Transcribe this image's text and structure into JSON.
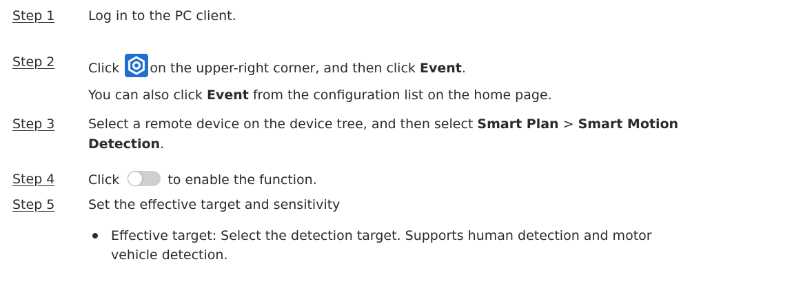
{
  "steps": [
    {
      "label": "Step 1",
      "text": "Log in to the PC client."
    },
    {
      "label": "Step 2",
      "pre": "Click",
      "icon": "gear-icon",
      "mid": "on the upper-right corner, and then click",
      "bold": "Event",
      "post": ".",
      "note_pre": "You can also click",
      "note_bold": "Event",
      "note_post": " from the configuration list on the home page."
    },
    {
      "label": "Step 3",
      "pre": "Select a remote device on the device tree, and then select",
      "bold1": "Smart Plan",
      "sep": " > ",
      "bold2": "Smart Motion",
      "bold2b": "Detection",
      "post": "."
    },
    {
      "label": "Step 4",
      "pre": "Click",
      "icon": "toggle-icon",
      "post": "to enable the function."
    },
    {
      "label": "Step 5",
      "text": "Set the effective target and sensitivity"
    }
  ],
  "bullets": [
    {
      "line1": "Effective target: Select the detection target. Supports human detection and motor",
      "line2": "vehicle detection."
    }
  ],
  "colors": {
    "accent": "#1f6fd1",
    "text": "#2b2b2b",
    "toggle_off": "#cfcfcf"
  }
}
